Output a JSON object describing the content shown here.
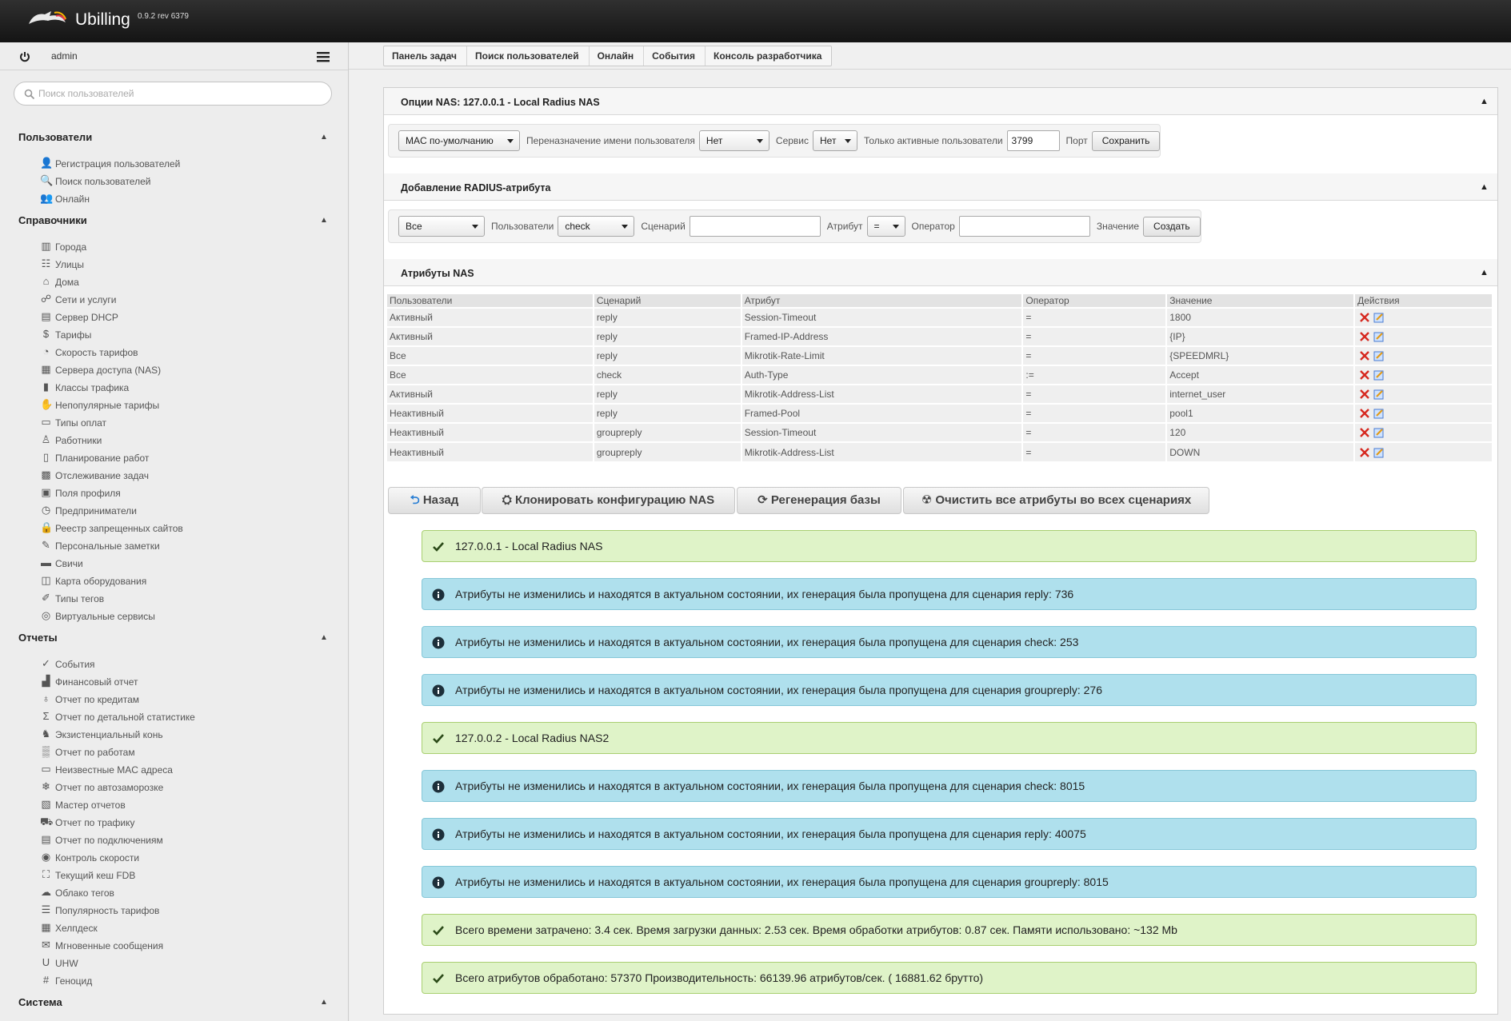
{
  "app": {
    "name": "Ubilling",
    "version": "0.9.2 rev 6379"
  },
  "sidebar": {
    "user": "admin",
    "search_placeholder": "Поиск пользователей",
    "sections": [
      {
        "title": "Пользователи",
        "items": [
          {
            "label": "Регистрация пользователей",
            "icon": "user-add-icon"
          },
          {
            "label": "Поиск пользователей",
            "icon": "search-icon"
          },
          {
            "label": "Онлайн",
            "icon": "users-icon"
          }
        ]
      },
      {
        "title": "Справочники",
        "items": [
          {
            "label": "Города",
            "icon": "city-icon"
          },
          {
            "label": "Улицы",
            "icon": "street-icon"
          },
          {
            "label": "Дома",
            "icon": "house-icon"
          },
          {
            "label": "Сети и услуги",
            "icon": "network-icon"
          },
          {
            "label": "Сервер DHCP",
            "icon": "server-icon"
          },
          {
            "label": "Тарифы",
            "icon": "dollar-icon"
          },
          {
            "label": "Скорость тарифов",
            "icon": "speed-icon"
          },
          {
            "label": "Сервера доступа (NAS)",
            "icon": "nas-icon"
          },
          {
            "label": "Классы трафика",
            "icon": "traffic-light-icon"
          },
          {
            "label": "Непопулярные тарифы",
            "icon": "thumb-down-icon"
          },
          {
            "label": "Типы оплат",
            "icon": "payment-icon"
          },
          {
            "label": "Работники",
            "icon": "worker-icon"
          },
          {
            "label": "Планирование работ",
            "icon": "clipboard-icon"
          },
          {
            "label": "Отслеживание задач",
            "icon": "tasks-icon"
          },
          {
            "label": "Поля профиля",
            "icon": "fields-icon"
          },
          {
            "label": "Предприниматели",
            "icon": "clock-icon"
          },
          {
            "label": "Реестр запрещенных сайтов",
            "icon": "lock-icon"
          },
          {
            "label": "Персональные заметки",
            "icon": "pin-icon"
          },
          {
            "label": "Свичи",
            "icon": "switch-icon"
          },
          {
            "label": "Карта оборудования",
            "icon": "map-icon"
          },
          {
            "label": "Типы тегов",
            "icon": "tag-icon"
          },
          {
            "label": "Виртуальные сервисы",
            "icon": "virtual-icon"
          }
        ]
      },
      {
        "title": "Отчеты",
        "items": [
          {
            "label": "События",
            "icon": "check-circle-icon"
          },
          {
            "label": "Финансовый отчет",
            "icon": "chart-icon"
          },
          {
            "label": "Отчет по кредитам",
            "icon": "credit-icon"
          },
          {
            "label": "Отчет по детальной статистике",
            "icon": "sigma-icon"
          },
          {
            "label": "Экзистенциальный конь",
            "icon": "horse-icon"
          },
          {
            "label": "Отчет по работам",
            "icon": "work-icon"
          },
          {
            "label": "Неизвестные MAC адреса",
            "icon": "mac-icon"
          },
          {
            "label": "Отчет по автозаморозке",
            "icon": "snowflake-icon"
          },
          {
            "label": "Мастер отчетов",
            "icon": "wizard-icon"
          },
          {
            "label": "Отчет по трафику",
            "icon": "truck-icon"
          },
          {
            "label": "Отчет по подключениям",
            "icon": "connection-icon"
          },
          {
            "label": "Контроль скорости",
            "icon": "speed-control-icon"
          },
          {
            "label": "Текущий кеш FDB",
            "icon": "fdb-icon"
          },
          {
            "label": "Облако тегов",
            "icon": "cloud-icon"
          },
          {
            "label": "Популярность тарифов",
            "icon": "popularity-icon"
          },
          {
            "label": "Хелпдеск",
            "icon": "helpdesk-icon"
          },
          {
            "label": "Мгновенные сообщения",
            "icon": "message-icon"
          },
          {
            "label": "UHW",
            "icon": "uhw-icon"
          },
          {
            "label": "Геноцид",
            "icon": "hash-icon"
          }
        ]
      },
      {
        "title": "Система",
        "items": []
      }
    ]
  },
  "breadcrumbs": [
    "Панель задач",
    "Поиск пользователей",
    "Онлайн",
    "События",
    "Консоль разработчика"
  ],
  "nas_options": {
    "title": "Опции NAS: 127.0.0.1 - Local Radius NAS",
    "mac_select": "MAC по-умолчанию",
    "rename_label": "Переназначение имени пользователя",
    "rename_value": "Нет",
    "service_label": "Сервис",
    "service_value": "Нет",
    "active_only_label": "Только активные пользователи",
    "port_value": "3799",
    "port_label": "Порт",
    "save_label": "Сохранить"
  },
  "add_attr": {
    "title": "Добавление RADIUS-атрибута",
    "users_select": "Все",
    "users_label": "Пользователи",
    "scenario_select": "check",
    "scenario_label": "Сценарий",
    "attribute_label": "Атрибут",
    "operator_select": "=",
    "operator_label": "Оператор",
    "value_label": "Значение",
    "create_label": "Создать"
  },
  "nas_attrs": {
    "title": "Атрибуты NAS",
    "columns": [
      "Пользователи",
      "Сценарий",
      "Атрибут",
      "Оператор",
      "Значение",
      "Действия"
    ],
    "rows": [
      [
        "Активный",
        "reply",
        "Session-Timeout",
        "=",
        "1800"
      ],
      [
        "Активный",
        "reply",
        "Framed-IP-Address",
        "=",
        "{IP}"
      ],
      [
        "Все",
        "reply",
        "Mikrotik-Rate-Limit",
        "=",
        "{SPEEDMRL}"
      ],
      [
        "Все",
        "check",
        "Auth-Type",
        ":=",
        "Accept"
      ],
      [
        "Активный",
        "reply",
        "Mikrotik-Address-List",
        "=",
        "internet_user"
      ],
      [
        "Неактивный",
        "reply",
        "Framed-Pool",
        "=",
        "pool1"
      ],
      [
        "Неактивный",
        "groupreply",
        "Session-Timeout",
        "=",
        "120"
      ],
      [
        "Неактивный",
        "groupreply",
        "Mikrotik-Address-List",
        "=",
        "DOWN"
      ]
    ]
  },
  "actions": {
    "back": "Назад",
    "clone": "Клонировать конфигурацию NAS",
    "regen": "Регенерация базы",
    "clear": "Очистить все атрибуты во всех сценариях"
  },
  "messages": [
    {
      "type": "ok",
      "text": "127.0.0.1 - Local Radius NAS"
    },
    {
      "type": "info",
      "text": "Атрибуты не изменились и находятся в актуальном состоянии, их генерация была пропущена для сценария reply: 736"
    },
    {
      "type": "info",
      "text": "Атрибуты не изменились и находятся в актуальном состоянии, их генерация была пропущена для сценария check: 253"
    },
    {
      "type": "info",
      "text": "Атрибуты не изменились и находятся в актуальном состоянии, их генерация была пропущена для сценария groupreply: 276"
    },
    {
      "type": "ok",
      "text": "127.0.0.2 - Local Radius NAS2"
    },
    {
      "type": "info",
      "text": "Атрибуты не изменились и находятся в актуальном состоянии, их генерация была пропущена для сценария check: 8015"
    },
    {
      "type": "info",
      "text": "Атрибуты не изменились и находятся в актуальном состоянии, их генерация была пропущена для сценария reply: 40075"
    },
    {
      "type": "info",
      "text": "Атрибуты не изменились и находятся в актуальном состоянии, их генерация была пропущена для сценария groupreply: 8015"
    },
    {
      "type": "ok",
      "text": "Всего времени затрачено: 3.4 сек. Время загрузки данных: 2.53 сек. Время обработки атрибутов: 0.87 сек. Памяти использовано: ~132 Mb"
    },
    {
      "type": "ok",
      "text": "Всего атрибутов обработано: 57370 Производительность: 66139.96 атрибутов/сек. ( 16881.62 брутто)"
    }
  ],
  "colors": {
    "ok_bg": "#dff3c8",
    "info_bg": "#afe0ed",
    "topbar": "#1e1e1e"
  }
}
